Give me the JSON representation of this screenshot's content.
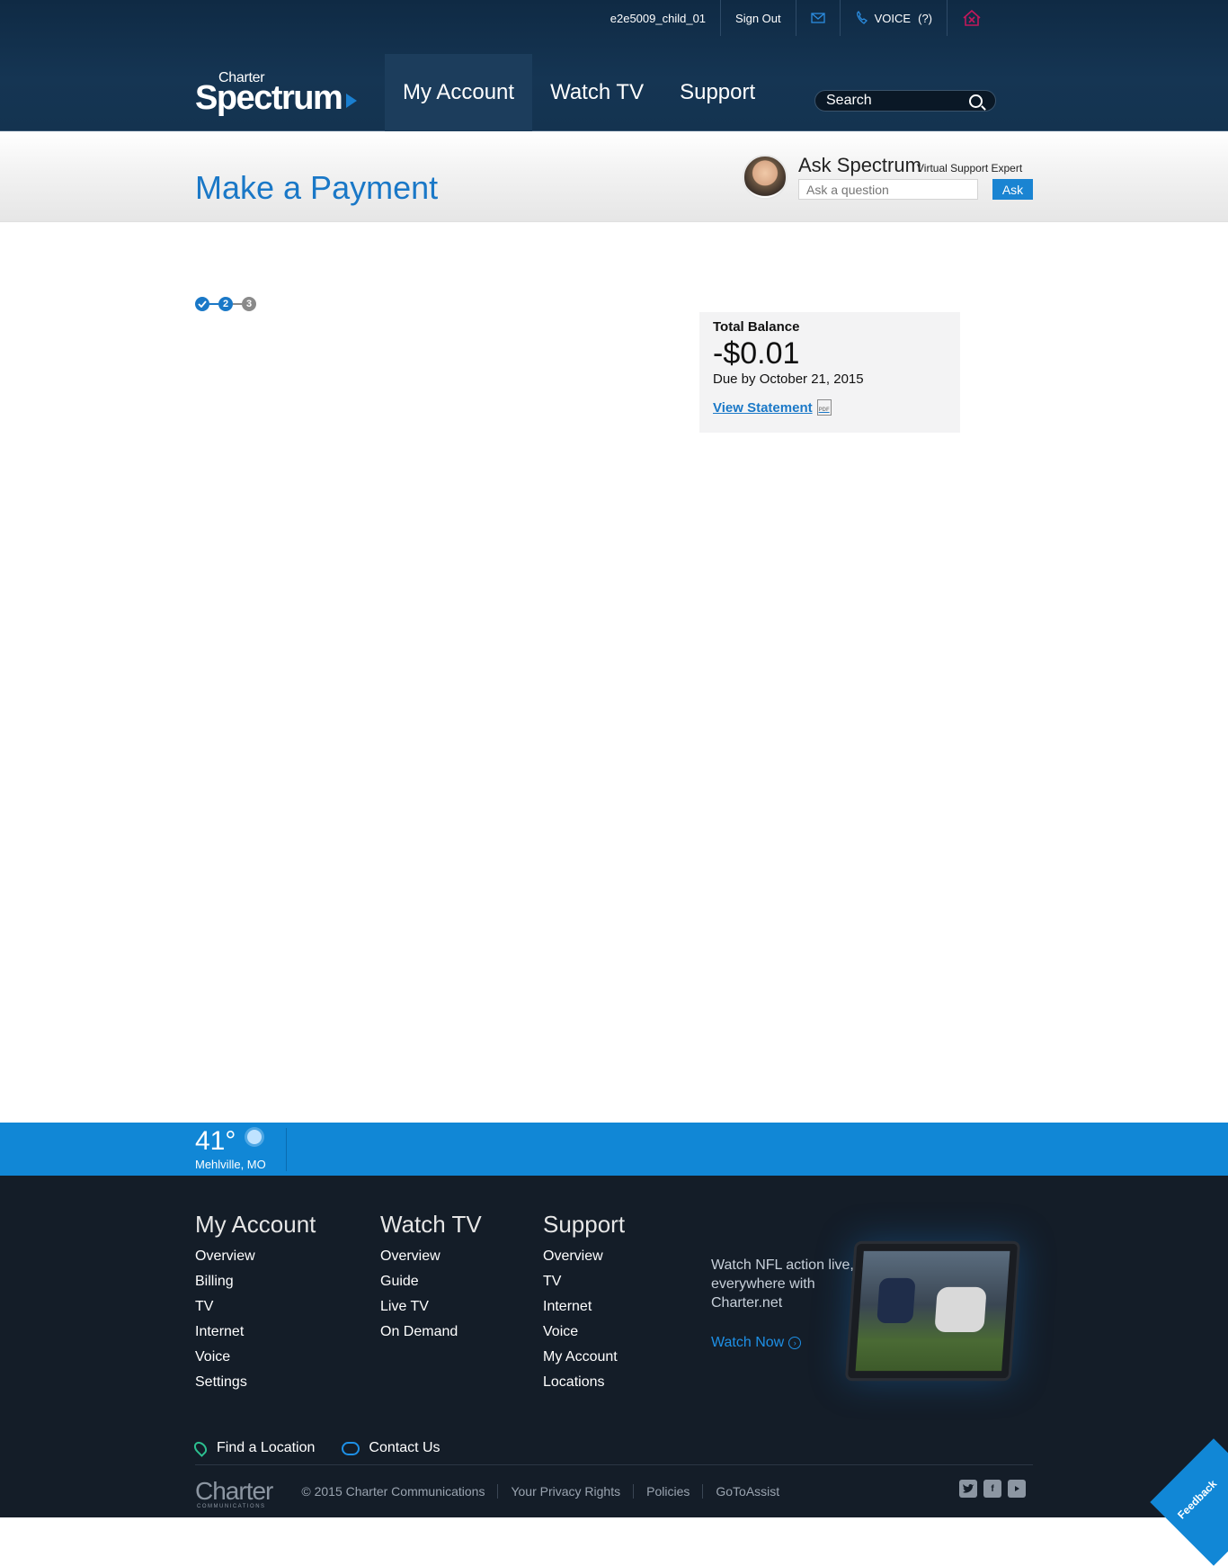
{
  "topbar": {
    "user": "e2e5009_child_01",
    "sign_out": "Sign Out",
    "voice": "VOICE",
    "voice_count": "(?)"
  },
  "logo": {
    "small": "Charter",
    "big": "Spectrum"
  },
  "nav": {
    "my_account": "My Account",
    "watch_tv": "Watch TV",
    "support": "Support"
  },
  "search": {
    "label": "Search"
  },
  "page": {
    "title": "Make a Payment"
  },
  "ask": {
    "title": "Ask Spectrum",
    "subtitle": "Virtual Support Expert",
    "placeholder": "Ask a question",
    "button": "Ask"
  },
  "steps": {
    "current": "2",
    "future": "3",
    "current_step_index": 2,
    "total_steps": 3
  },
  "balance": {
    "label": "Total Balance",
    "amount": "-$0.01",
    "due": "Due by October 21, 2015",
    "link": "View Statement",
    "pdf": "PDF"
  },
  "weather": {
    "temp": "41°",
    "location": "Mehlville, MO"
  },
  "footer": {
    "columns": [
      {
        "heading": "My Account",
        "links": [
          "Overview",
          "Billing",
          "TV",
          "Internet",
          "Voice",
          "Settings"
        ]
      },
      {
        "heading": "Watch TV",
        "links": [
          "Overview",
          "Guide",
          "Live TV",
          "On Demand"
        ]
      },
      {
        "heading": "Support",
        "links": [
          "Overview",
          "TV",
          "Internet",
          "Voice",
          "My Account",
          "Locations"
        ]
      }
    ],
    "promo": {
      "text": "Watch NFL action live, everywhere with Charter.net",
      "link": "Watch Now"
    },
    "tools": {
      "find": "Find a Location",
      "contact": "Contact Us"
    },
    "logo": "Charter",
    "logo_sub": "COMMUNICATIONS",
    "legal": [
      "© 2015 Charter Communications",
      "Your Privacy Rights",
      "Policies",
      "GoToAssist"
    ],
    "feedback": "Feedback"
  },
  "colors": {
    "brand_blue": "#1187d6",
    "header_navy": "#0f2a44",
    "footer_dark": "#141d28"
  }
}
